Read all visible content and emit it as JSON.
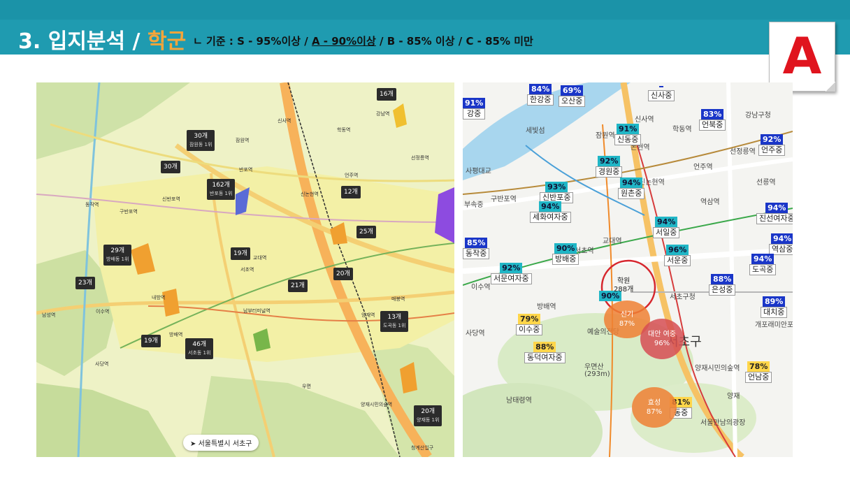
{
  "header": {
    "title_main": "3. 입지분석 / ",
    "title_accent": "학군",
    "criteria_prefix": "ㄴ 기준 : S - 95%이상 / ",
    "criteria_a": "A - 90%이상",
    "criteria_rest": " / B - 85% 이상 / C - 85% 미만"
  },
  "grade": "A",
  "left_map": {
    "location_label": "서울특별시 서초구",
    "clusters": [
      {
        "count": "16개",
        "sub": ""
      },
      {
        "count": "30개",
        "sub": "잠원동 1위"
      },
      {
        "count": "30개",
        "sub": ""
      },
      {
        "count": "162개",
        "sub": "반포동 1위"
      },
      {
        "count": "12개",
        "sub": ""
      },
      {
        "count": "25개",
        "sub": ""
      },
      {
        "count": "29개",
        "sub": "방배동 1위"
      },
      {
        "count": "19개",
        "sub": ""
      },
      {
        "count": "23개",
        "sub": ""
      },
      {
        "count": "21개",
        "sub": ""
      },
      {
        "count": "20개",
        "sub": ""
      },
      {
        "count": "13개",
        "sub": "도곡동 1위"
      },
      {
        "count": "19개",
        "sub": ""
      },
      {
        "count": "46개",
        "sub": "서초동 1위"
      },
      {
        "count": "20개",
        "sub": "양재동 1위"
      }
    ],
    "stations": [
      "신사역",
      "잠원역",
      "반포역",
      "신논현역",
      "강남역",
      "양재역",
      "서초역",
      "교대역",
      "내방역",
      "이수역",
      "사당역",
      "방배역",
      "남부터미널역",
      "양재시민의숲역",
      "우면",
      "매봉역",
      "선정릉역",
      "언주역",
      "학동역",
      "구반포역",
      "신반포역",
      "동작역",
      "남성역",
      "청계산입구"
    ]
  },
  "right_map": {
    "district": "서초구",
    "schools": [
      {
        "pct": "84%",
        "name": "한강중",
        "style": "blue"
      },
      {
        "pct": "69%",
        "name": "오산중",
        "style": "blue"
      },
      {
        "pct": "",
        "name": "신사중",
        "style": "blue"
      },
      {
        "pct": "91%",
        "name": "강중",
        "style": "blue"
      },
      {
        "pct": "83%",
        "name": "언북중",
        "style": "blue"
      },
      {
        "pct": "91%",
        "name": "신동중",
        "style": "teal"
      },
      {
        "pct": "92%",
        "name": "언주중",
        "style": "blue"
      },
      {
        "pct": "92%",
        "name": "경원중",
        "style": "teal"
      },
      {
        "pct": "93%",
        "name": "신반포중",
        "style": "teal"
      },
      {
        "pct": "94%",
        "name": "원촌중",
        "style": "teal"
      },
      {
        "pct": "94%",
        "name": "세화여자중",
        "style": "teal"
      },
      {
        "pct": "94%",
        "name": "진선여자중",
        "style": "blue"
      },
      {
        "pct": "85%",
        "name": "동작중",
        "style": "blue"
      },
      {
        "pct": "94%",
        "name": "서일중",
        "style": "teal"
      },
      {
        "pct": "90%",
        "name": "방배중",
        "style": "teal"
      },
      {
        "pct": "96%",
        "name": "서운중",
        "style": "teal"
      },
      {
        "pct": "94%",
        "name": "역삼중",
        "style": "blue"
      },
      {
        "pct": "92%",
        "name": "서문여자중",
        "style": "teal"
      },
      {
        "pct": "94%",
        "name": "도곡중",
        "style": "blue"
      },
      {
        "pct": "88%",
        "name": "은성중",
        "style": "blue"
      },
      {
        "pct": "89%",
        "name": "대치중",
        "style": "blue"
      },
      {
        "pct": "79%",
        "name": "이수중",
        "style": "yel"
      },
      {
        "pct": "88%",
        "name": "동덕여자중",
        "style": "yel"
      },
      {
        "pct": "78%",
        "name": "언남중",
        "style": "yel"
      },
      {
        "pct": "81%",
        "name": "동중",
        "style": "yel"
      },
      {
        "pct": "90%",
        "name": "",
        "style": "teal"
      }
    ],
    "places": [
      "세빛섬",
      "신사역",
      "잠원역",
      "논현역",
      "강남구청",
      "학동역",
      "언주역",
      "선정릉역",
      "선릉역",
      "신논현역",
      "역삼역",
      "교대역",
      "서초역",
      "서초구청",
      "이수역",
      "방배역",
      "사당역",
      "예술의전당",
      "우면산",
      "(293m)",
      "양재시민의숲역",
      "양재",
      "남태령역",
      "서울만남의광장",
      "개포래미안포레스",
      "구반포역",
      "부속중",
      "사평대교"
    ],
    "academy": {
      "name": "학원",
      "count": "288개"
    },
    "bubbles": [
      {
        "name": "신기",
        "pct": "87%"
      },
      {
        "name": "대안 여중",
        "pct": "96%"
      },
      {
        "name": "효성",
        "pct": "87%"
      }
    ]
  }
}
